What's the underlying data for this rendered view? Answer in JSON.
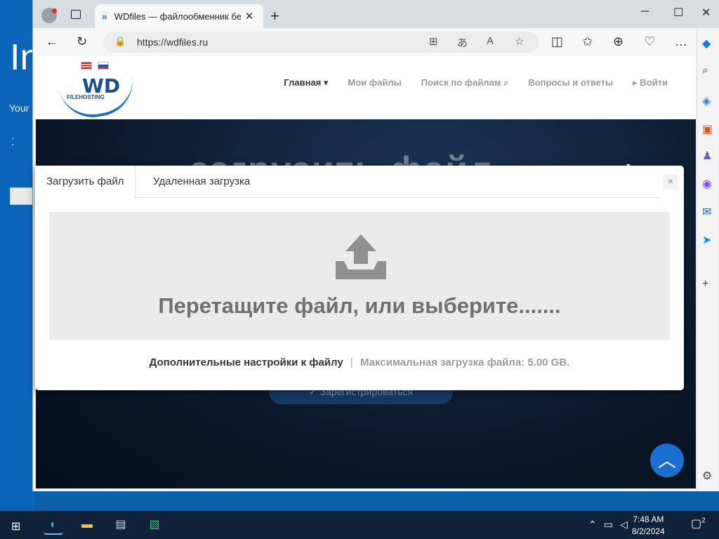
{
  "desktop_app": {
    "big_text": "In",
    "small_text": "Your",
    "dots": "⁚"
  },
  "browser": {
    "tab_title": "WDfiles — файлообменник бес",
    "tab_close": "✕",
    "new_tab": "+",
    "url": "https://wdfiles.ru"
  },
  "site": {
    "nav": [
      {
        "label": "Главная ▾"
      },
      {
        "label": "Мои файлы"
      },
      {
        "label": "Поиск по файлам ⌕"
      },
      {
        "label": "Вопросы и ответы"
      },
      {
        "label": "▸ Войти"
      }
    ],
    "logo_text": "WD",
    "logo_sub": "FILEHOSTING",
    "hero_title": "загрузить файл",
    "register_button": "✓ Зарегистрироваться"
  },
  "modal": {
    "tab_upload": "Загрузить файл",
    "tab_remote": "Удаленная загрузка",
    "close": "×",
    "drop_text": "Перетащите файл, или выберите.......",
    "footer_link": "Дополнительные настройки к файлу",
    "footer_sep": "|",
    "footer_max": "Максимальная загрузка файла: 5.00 GB."
  },
  "taskbar": {
    "time": "7:48 AM",
    "date": "8/2/2024",
    "notifications": "2"
  }
}
